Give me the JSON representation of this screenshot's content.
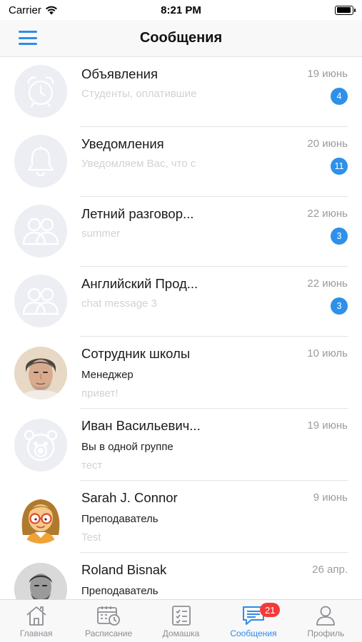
{
  "status_bar": {
    "carrier": "Carrier",
    "time": "8:21 PM",
    "battery_level": 0.92
  },
  "nav": {
    "title": "Сообщения"
  },
  "conversations": [
    {
      "title": "Объявления",
      "date": "19 июнь",
      "preview": "Студенты, оплатившие",
      "badge": "4",
      "avatar_icon": "alarm-clock-icon"
    },
    {
      "title": "Уведомления",
      "date": "20 июнь",
      "preview": "Уведомляем Вас, что с",
      "badge": "11",
      "avatar_icon": "bell-icon"
    },
    {
      "title": "Летний разговор...",
      "date": "22 июнь",
      "preview": "summer",
      "badge": "3",
      "avatar_icon": "group-icon"
    },
    {
      "title": "Английский Прод...",
      "date": "22 июнь",
      "preview": "chat message 3",
      "badge": "3",
      "avatar_icon": "group-icon"
    },
    {
      "title": "Сотрудник школы",
      "date": "10 июль",
      "role": "Менеджер",
      "preview": "привет!",
      "avatar_icon": "person-photo"
    },
    {
      "title": "Иван Васильевич...",
      "date": "19 июнь",
      "role": "Вы в одной группе",
      "preview": "тест",
      "avatar_icon": "bear-icon"
    },
    {
      "title": "Sarah J. Connor",
      "date": "9 июнь",
      "role": "Преподаватель",
      "preview": "Test",
      "avatar_icon": "girl-illustration"
    },
    {
      "title": "Roland  Bisnak",
      "date": "26 апр.",
      "role": "Преподаватель",
      "preview": "",
      "avatar_icon": "person-photo"
    }
  ],
  "tabs": [
    {
      "label": "Главная",
      "icon": "home-icon"
    },
    {
      "label": "Расписание",
      "icon": "calendar-clock-icon"
    },
    {
      "label": "Домашка",
      "icon": "checklist-icon"
    },
    {
      "label": "Сообщения",
      "icon": "chat-icon",
      "badge": "21",
      "active": true
    },
    {
      "label": "Профиль",
      "icon": "person-icon"
    }
  ],
  "colors": {
    "accent": "#2d8ce8",
    "badge_blue": "#2e90e8",
    "badge_red": "#f23a3a",
    "avatar_bg": "#eceef3"
  }
}
